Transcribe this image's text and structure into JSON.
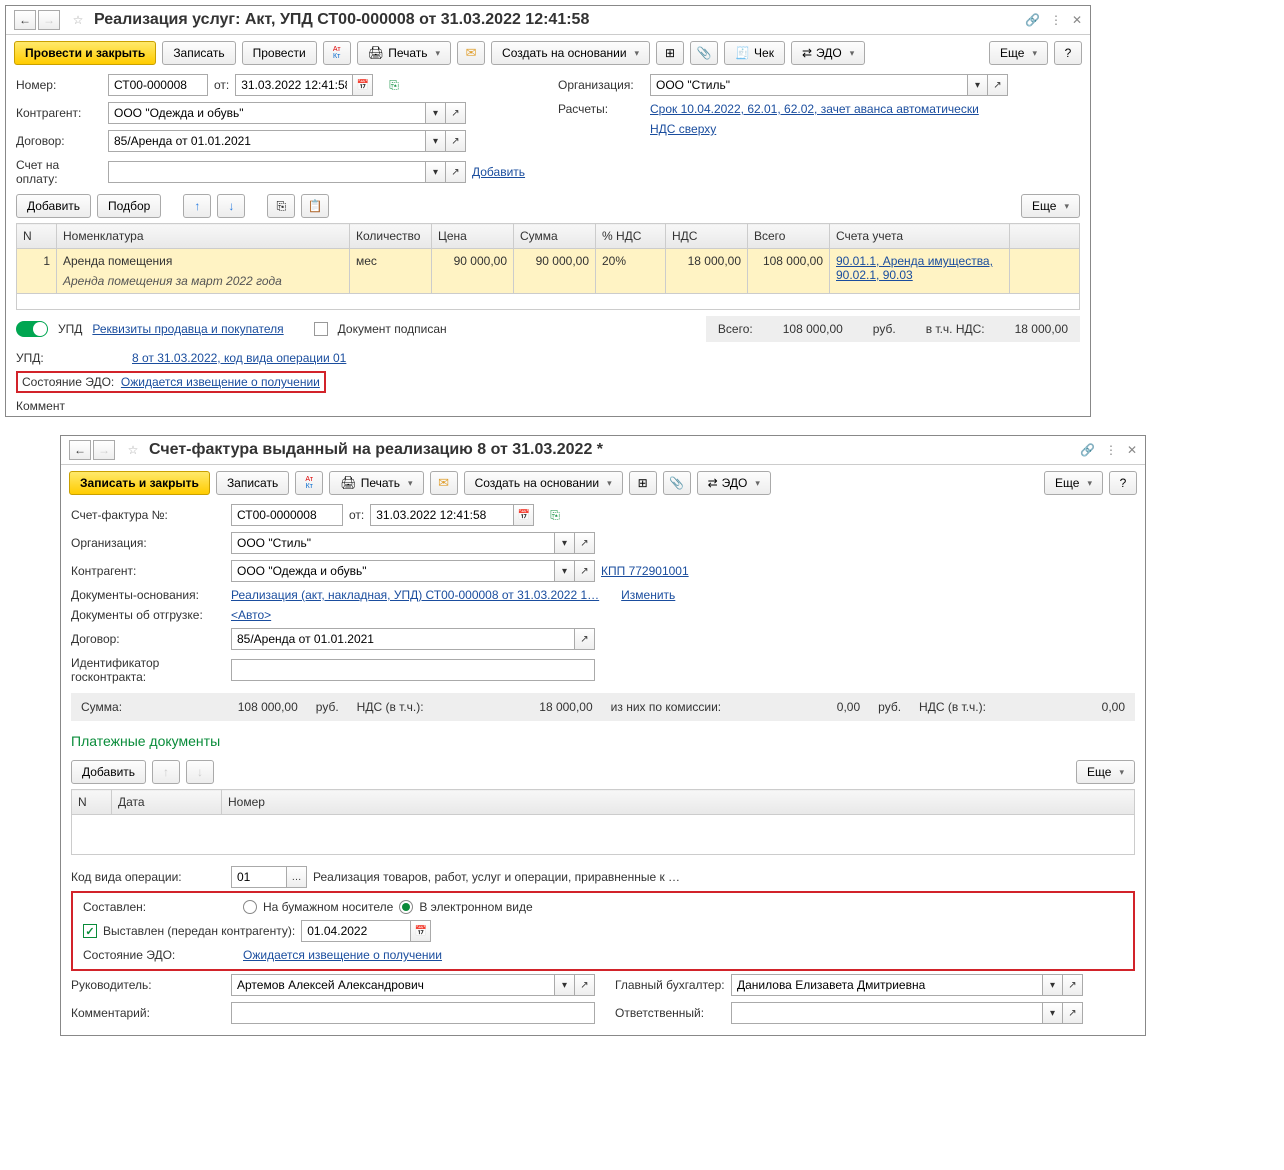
{
  "w1": {
    "title": "Реализация услуг: Акт, УПД СТ00-000008 от 31.03.2022 12:41:58",
    "toolbar": {
      "post_close": "Провести и закрыть",
      "write": "Записать",
      "post": "Провести",
      "print": "Печать",
      "create_based": "Создать на основании",
      "check": "Чек",
      "edo": "ЭДО",
      "more": "Еще"
    },
    "fields": {
      "number_label": "Номер:",
      "number": "СТ00-000008",
      "from_label": "от:",
      "date": "31.03.2022 12:41:58",
      "org_label": "Организация:",
      "org": "ООО \"Стиль\"",
      "contragent_label": "Контрагент:",
      "contragent": "ООО \"Одежда и обувь\"",
      "payments_label": "Расчеты:",
      "payments_link": "Срок 10.04.2022, 62.01, 62.02, зачет аванса автоматически",
      "contract_label": "Договор:",
      "contract": "85/Аренда от 01.01.2021",
      "nds_link": "НДС сверху",
      "invoice_label": "Счет на оплату:",
      "add_link": "Добавить"
    },
    "table_toolbar": {
      "add": "Добавить",
      "select": "Подбор",
      "more": "Еще"
    },
    "table": {
      "headers": {
        "n": "N",
        "nom": "Номенклатура",
        "qty": "Количество",
        "price": "Цена",
        "sum": "Сумма",
        "pct": "% НДС",
        "nds": "НДС",
        "total": "Всего",
        "acc": "Счета учета"
      },
      "row": {
        "n": "1",
        "nom": "Аренда помещения",
        "nom_sub": "Аренда помещения за март 2022 года",
        "qty": "мес",
        "price": "90 000,00",
        "sum": "90 000,00",
        "pct": "20%",
        "nds": "18 000,00",
        "total": "108 000,00",
        "acc": "90.01.1, Аренда имущества, 90.02.1, 90.03"
      }
    },
    "totals": {
      "upd": "УПД",
      "requisites": "Реквизиты продавца и покупателя",
      "signed": "Документ подписан",
      "total_label": "Всего:",
      "total": "108 000,00",
      "rub": "руб.",
      "nds_label": "в т.ч. НДС:",
      "nds": "18 000,00"
    },
    "upd_row": {
      "label": "УПД:",
      "link": "8 от 31.03.2022, код вида операции 01"
    },
    "edo_row": {
      "label": "Состояние ЭДО:",
      "link": "Ожидается извещение о получении"
    },
    "comment": "Коммент"
  },
  "w2": {
    "title": "Счет-фактура выданный на реализацию 8 от 31.03.2022 *",
    "toolbar": {
      "write_close": "Записать и закрыть",
      "write": "Записать",
      "print": "Печать",
      "create_based": "Создать на основании",
      "edo": "ЭДО",
      "more": "Еще"
    },
    "fields": {
      "sf_label": "Счет-фактура №:",
      "sf": "СТ00-0000008",
      "from_label": "от:",
      "date": "31.03.2022 12:41:58",
      "org_label": "Организация:",
      "org": "ООО \"Стиль\"",
      "contragent_label": "Контрагент:",
      "contragent": "ООО \"Одежда и обувь\"",
      "kpp": "КПП 772901001",
      "docs_label": "Документы-основания:",
      "docs_link": "Реализация (акт, накладная, УПД) СТ00-000008 от 31.03.2022 1…",
      "change": "Изменить",
      "ship_label": "Документы об отгрузке:",
      "ship_link": "<Авто>",
      "contract_label": "Договор:",
      "contract": "85/Аренда от 01.01.2021",
      "gosid_label": "Идентификатор госконтракта:"
    },
    "sum_row": {
      "sum_label": "Сумма:",
      "sum": "108 000,00",
      "rub1": "руб.",
      "nds_incl_label": "НДС (в т.ч.):",
      "nds_incl": "18 000,00",
      "comm_label": "из них по комиссии:",
      "comm": "0,00",
      "rub2": "руб.",
      "nds2_label": "НДС (в т.ч.):",
      "nds2": "0,00"
    },
    "section": "Платежные документы",
    "pay_toolbar": {
      "add": "Добавить",
      "more": "Еще"
    },
    "pay_table": {
      "n": "N",
      "date": "Дата",
      "num": "Номер"
    },
    "op_code": {
      "label": "Код вида операции:",
      "val": "01",
      "desc": "Реализация товаров, работ, услуг и операции, приравненные к …"
    },
    "composed": {
      "label": "Составлен:",
      "paper": "На бумажном носителе",
      "elec": "В электронном виде",
      "issued": "Выставлен (передан контрагенту):",
      "issued_date": "01.04.2022",
      "edo_label": "Состояние ЭДО:",
      "edo_link": "Ожидается извещение о получении"
    },
    "bottom": {
      "head_label": "Руководитель:",
      "head": "Артемов Алексей Александрович",
      "acc_label": "Главный бухгалтер:",
      "acc": "Данилова Елизавета Дмитриевна",
      "comment_label": "Комментарий:",
      "resp_label": "Ответственный:"
    }
  }
}
